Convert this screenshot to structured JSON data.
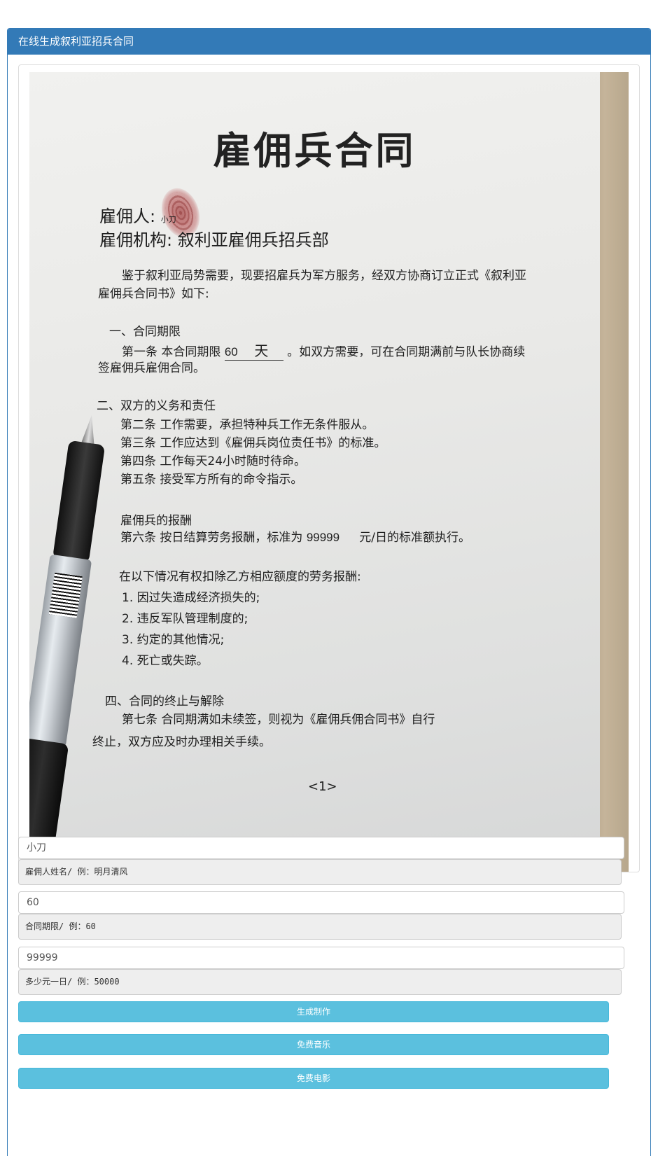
{
  "panel": {
    "title": "在线生成叙利亚招兵合同"
  },
  "contract": {
    "title": "雇佣兵合同",
    "employer_label": "雇佣人:",
    "employer_name": "小刀",
    "org_line": "雇佣机构: 叙利亚雇佣兵招兵部",
    "intro_1": "鉴于叙利亚局势需要，现要招雇兵为军方服务，经双方协商订立正式《叙利亚",
    "intro_2": "雇佣兵合同书》如下:",
    "s1_title": "一、合同期限",
    "s1_a1_pre": "第一条   本合同期限",
    "s1_days": "60",
    "s1_unit": "天",
    "s1_a1_post": "。如双方需要，可在合同期满前与队长协商续",
    "s1_a1_cont": "签雇佣兵雇佣合同。",
    "s2_title": "二、双方的义务和责任",
    "s2_a2": "第二条   工作需要，承担特种兵工作无条件服从。",
    "s2_a3": "第三条   工作应达到《雇佣兵岗位责任书》的标准。",
    "s2_a4": "第四条   工作每天24小时随时待命。",
    "s2_a5": "第五条   接受军方所有的命令指示。",
    "s3_title": "雇佣兵的报酬",
    "s3_a6_pre": "第六条   按日结算劳务报酬，标准为",
    "s3_amount": "99999",
    "s3_a6_post": "元/日的标准额执行。",
    "deduct_title": "在以下情况有权扣除乙方相应额度的劳务报酬:",
    "deduct_1": "1.  因过失造成经济损失的;",
    "deduct_2": "2.  违反军队管理制度的;",
    "deduct_3": "3.  约定的其他情况;",
    "deduct_4": "4.  死亡或失踪。",
    "s4_title": "四、合同的终止与解除",
    "s4_a7": "第七条   合同期满如未续签，则视为《雇佣兵佣合同书》自行",
    "s4_a7_cont": "终止，双方应及时办理相关手续。",
    "page_no": "<1>"
  },
  "form": {
    "name_value": "小刀",
    "name_addon": "雇佣人姓名/ 例：明月清风",
    "days_value": "60",
    "days_addon": "合同期限/ 例：60",
    "pay_value": "99999",
    "pay_addon": "多少元一日/ 例：50000"
  },
  "buttons": {
    "generate": "生成制作",
    "music": "免费音乐",
    "movie": "免费电影"
  },
  "colors": {
    "heading": "#337ab7",
    "button": "#5bc0de",
    "addon_bg": "#eeeeee"
  }
}
